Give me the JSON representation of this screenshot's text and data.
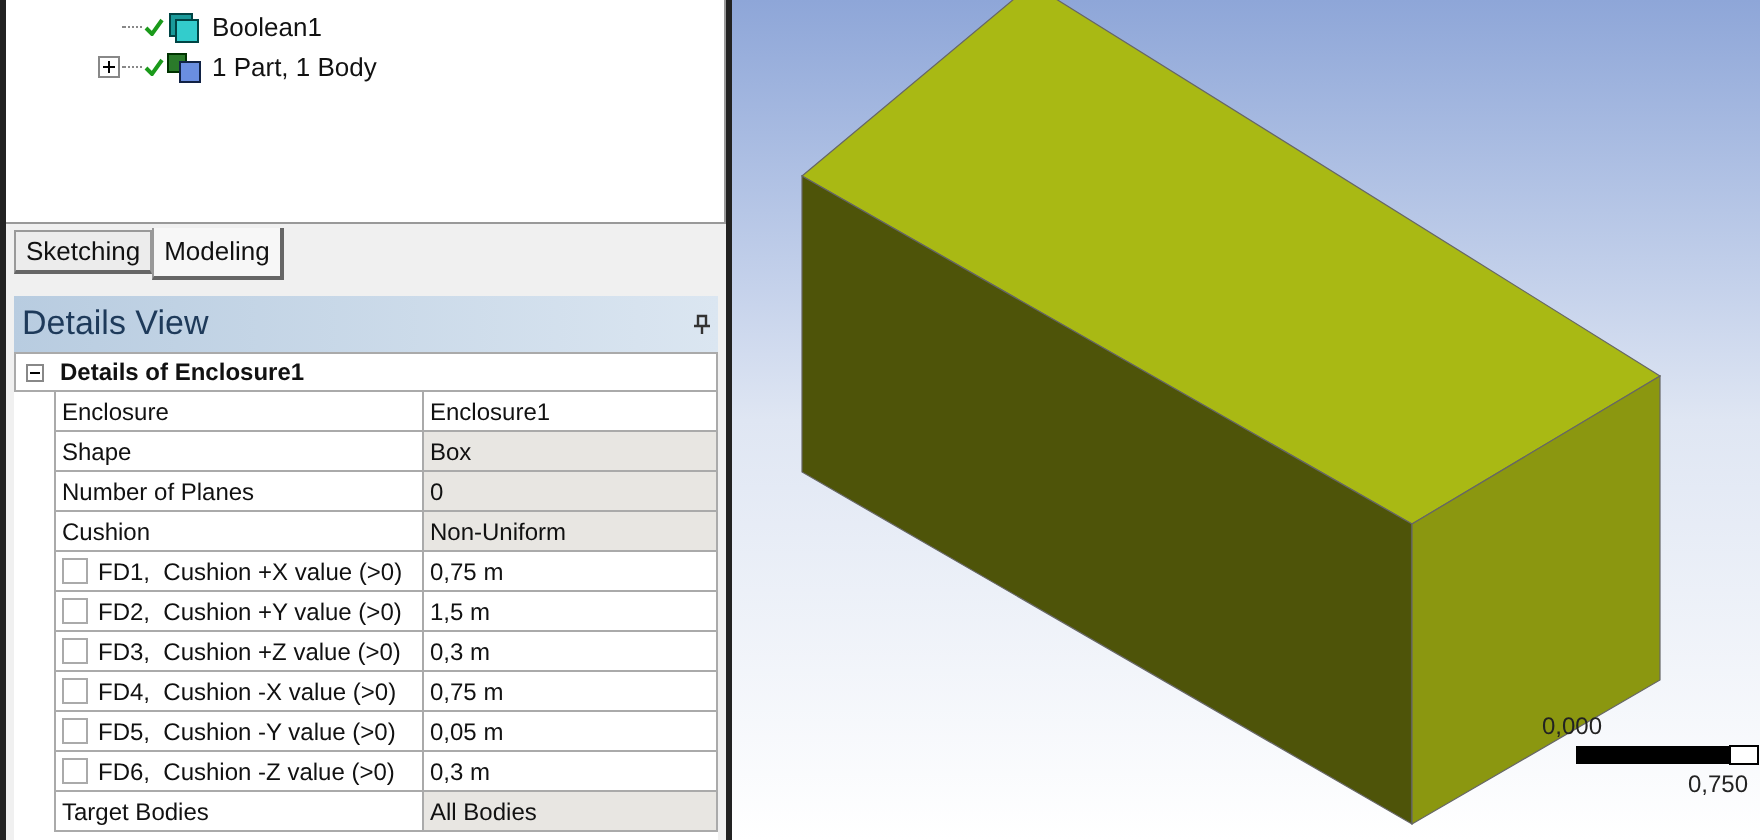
{
  "tree": {
    "items": [
      {
        "label": "Boolean1",
        "kind": "boolean",
        "has_children": false
      },
      {
        "label": "1 Part, 1 Body",
        "kind": "part",
        "has_children": true
      }
    ]
  },
  "tabs": [
    {
      "label": "Sketching",
      "selected": false
    },
    {
      "label": "Modeling",
      "selected": true
    }
  ],
  "details": {
    "title": "Details View",
    "group": {
      "label": "Details of Enclosure1",
      "expanded": true
    },
    "rows": [
      {
        "kind": "plain",
        "name": "Enclosure",
        "value": "Enclosure1",
        "shaded": false
      },
      {
        "kind": "plain",
        "name": "Shape",
        "value": "Box",
        "shaded": true
      },
      {
        "kind": "plain",
        "name": "Number of Planes",
        "value": "0",
        "shaded": true
      },
      {
        "kind": "plain",
        "name": "Cushion",
        "value": "Non-Uniform",
        "shaded": true
      },
      {
        "kind": "parameter",
        "checked": false,
        "name": "FD1,  Cushion +X value (>0)",
        "value": "0,75 m",
        "shaded": false
      },
      {
        "kind": "parameter",
        "checked": false,
        "name": "FD2,  Cushion +Y value (>0)",
        "value": "1,5 m",
        "shaded": false
      },
      {
        "kind": "parameter",
        "checked": false,
        "name": "FD3,  Cushion +Z value (>0)",
        "value": "0,3 m",
        "shaded": false
      },
      {
        "kind": "parameter",
        "checked": false,
        "name": "FD4,  Cushion -X value (>0)",
        "value": "0,75 m",
        "shaded": false
      },
      {
        "kind": "parameter",
        "checked": false,
        "name": "FD5,  Cushion -Y value (>0)",
        "value": "0,05 m",
        "shaded": false
      },
      {
        "kind": "parameter",
        "checked": false,
        "name": "FD6,  Cushion -Z value (>0)",
        "value": "0,3 m",
        "shaded": false
      },
      {
        "kind": "plain",
        "name": "Target Bodies",
        "value": "All Bodies",
        "shaded": true
      }
    ]
  },
  "viewport": {
    "scale_start": "0,000",
    "scale_end": "0,750"
  }
}
